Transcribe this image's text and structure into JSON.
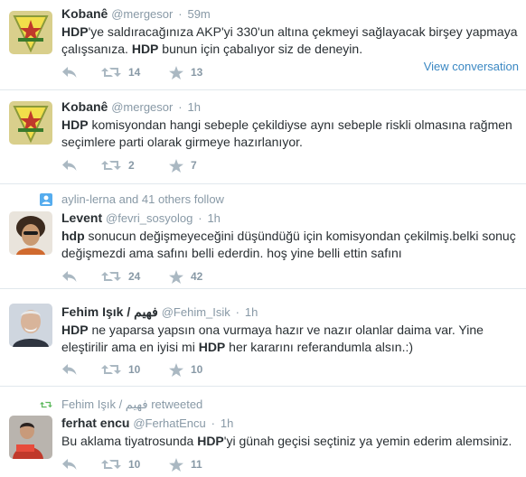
{
  "tweets": [
    {
      "name": "Kobanê",
      "handle": "@mergesor",
      "time": "59m",
      "text_html": "<b>HDP</b>'ye saldıracağınıza AKP'yi 330'un altına çekmeyi sağlayacak birşey yapmaya çalışsanıza. <b>HDP</b> bunun için çabalıyor siz de deneyin.",
      "retweets": "14",
      "favorites": "13",
      "view_conversation": "View conversation"
    },
    {
      "name": "Kobanê",
      "handle": "@mergesor",
      "time": "1h",
      "text_html": "<b>HDP</b> komisyondan hangi sebeple çekildiyse aynı sebeple riskli olmasına rağmen seçimlere parti olarak girmeye hazırlanıyor.",
      "retweets": "2",
      "favorites": "7"
    },
    {
      "context": "aylin-lerna and 41 others follow",
      "name": "Levent",
      "handle": "@fevri_sosyolog",
      "time": "1h",
      "text_html": "<b>hdp</b> sonucun değişmeyeceğini düşündüğü için komisyondan çekilmiş.belki sonuç değişmezdi ama safını belli ederdin. hoş yine belli ettin safını",
      "retweets": "24",
      "favorites": "42"
    },
    {
      "name": "Fehim Işık / فهيم",
      "handle": "@Fehim_Isik",
      "time": "1h",
      "text_html": "<b>HDP</b> ne yaparsa yapsın ona vurmaya hazır ve nazır olanlar daima var. Yine eleştirilir ama en iyisi mi <b>HDP</b> her kararını referandumla alsın.:)",
      "retweets": "10",
      "favorites": "10"
    },
    {
      "context": "Fehim Işık / فهيم retweeted",
      "name": "ferhat encu",
      "handle": "@FerhatEncu",
      "time": "1h",
      "text_html": "Bu aklama tiyatrosunda <b>HDP</b>'yi günah geçisi seçtiniz ya yemin ederim alemsiniz.",
      "retweets": "10",
      "favorites": "11"
    }
  ],
  "colors": {
    "text": "#292f33",
    "muted": "#8899a6",
    "link": "#3b88c3",
    "divider": "#e1e8ed"
  },
  "icons": [
    "reply-icon",
    "retweet-icon",
    "favorite-icon",
    "follow-context-icon",
    "retweet-context-icon"
  ]
}
